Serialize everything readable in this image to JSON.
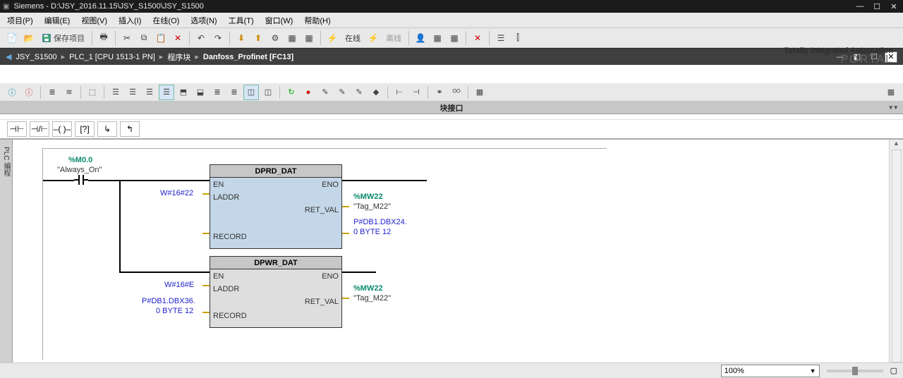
{
  "title": "Siemens - D:\\JSY_2016.11.15\\JSY_S1500\\JSY_S1500",
  "menus": [
    "项目(P)",
    "编辑(E)",
    "视图(V)",
    "插入(I)",
    "在线(O)",
    "选项(N)",
    "工具(T)",
    "窗口(W)",
    "帮助(H)"
  ],
  "toolbar": {
    "save_label": "保存项目",
    "online_label": "在线",
    "offline_label": "离线"
  },
  "tia": {
    "line1": "Totally Integrated Automation",
    "line2": "PORTAL"
  },
  "breadcrumb": [
    "JSY_S1500",
    "PLC_1 [CPU 1513-1 PN]",
    "程序块",
    "Danfoss_Profinet [FC13]"
  ],
  "panel_title": "块接口",
  "left_tab": "PLC 编程",
  "network": {
    "contact_addr": "%M0.0",
    "contact_name": "\"Always_On\"",
    "block1": {
      "title": "DPRD_DAT",
      "pins_left": [
        "EN",
        "LADDR",
        "",
        "",
        "RECORD"
      ],
      "pins_right": [
        "ENO",
        "",
        "RET_VAL",
        "",
        ""
      ],
      "laddr_val": "W#16#22",
      "retval_addr": "%MW22",
      "retval_name": "\"Tag_M22\"",
      "record_val1": "P#DB1.DBX24.",
      "record_val2": "0 BYTE 12"
    },
    "block2": {
      "title": "DPWR_DAT",
      "pins_left": [
        "EN",
        "LADDR",
        "",
        "RECORD"
      ],
      "pins_right": [
        "ENO",
        "",
        "RET_VAL",
        ""
      ],
      "laddr_val": "W#16#E",
      "record_val1": "P#DB1.DBX36.",
      "record_val2": "0 BYTE 12",
      "retval_addr": "%MW22",
      "retval_name": "\"Tag_M22\""
    }
  },
  "zoom": "100%"
}
